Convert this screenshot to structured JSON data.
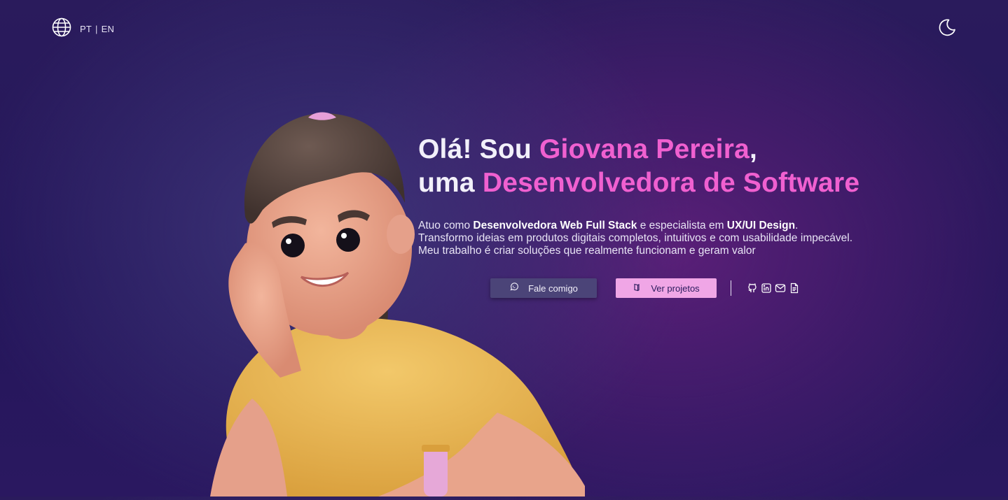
{
  "header": {
    "lang_pt": "PT",
    "lang_separator": "|",
    "lang_en": "EN",
    "globe_icon": "globe-icon",
    "theme_icon": "moon-icon"
  },
  "hero": {
    "title_line1_prefix": "Olá! Sou ",
    "title_line1_name": "Giovana Pereira",
    "title_line1_suffix": ",",
    "title_line2_prefix": "uma ",
    "title_line2_role": "Desenvolvedora de Software",
    "desc_part1": "Atuo como ",
    "desc_bold1": "Desenvolvedora Web Full Stack",
    "desc_part2": " e especialista em ",
    "desc_bold2": "UX/UI Design",
    "desc_part3": ".",
    "desc_part4": "Transformo ideias em produtos digitais completos, intuitivos e com usabilidade impecável. Meu trabalho é criar soluções que realmente funcionam e geram valor"
  },
  "actions": {
    "contact_label": "Fale comigo",
    "contact_icon": "whatsapp-icon",
    "projects_label": "Ver projetos",
    "projects_icon": "book-icon",
    "socials": [
      "github-icon",
      "linkedin-icon",
      "mail-icon",
      "document-icon"
    ]
  },
  "colors": {
    "background": "#24165a",
    "accent_pink": "#f060d0",
    "button_contact": "#4b4478",
    "button_projects": "#f0a6e6"
  }
}
